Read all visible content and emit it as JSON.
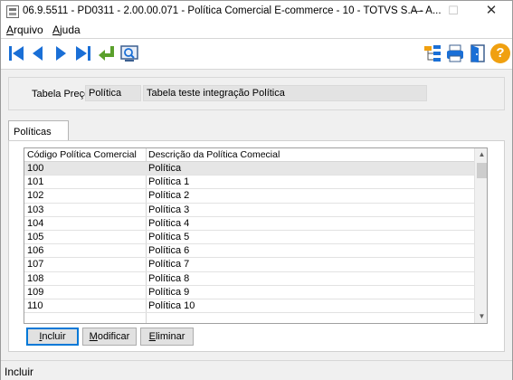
{
  "window": {
    "title": "06.9.5511 - PD0311 - 2.00.00.071 - Política Comercial E-commerce - 10 - TOTVS S.A - A...",
    "minimize_glyph": "—",
    "maximize_glyph": "☐",
    "close_glyph": "✕"
  },
  "menu": {
    "arquivo_prefix": "A",
    "arquivo_rest": "rquivo",
    "ajuda_prefix": "A",
    "ajuda_rest": "juda"
  },
  "toolbar": {
    "icons": [
      "first-record-icon",
      "previous-record-icon",
      "next-record-icon",
      "last-record-icon",
      "return-icon",
      "zoom-search-icon",
      "tree-icon",
      "print-icon",
      "exit-door-icon",
      "help-icon"
    ],
    "help_glyph": "?",
    "colors": {
      "nav_blue": "#1a6fd6",
      "return_green": "#5aa02c",
      "help_orange": "#f0a010"
    }
  },
  "header": {
    "label": "Tabela Preço:",
    "code_value": "Política",
    "description_value": "Tabela teste integração Política"
  },
  "tabs": [
    {
      "label": "Políticas"
    }
  ],
  "grid": {
    "columns": [
      "Código Política Comercial",
      "Descrição da Política Comecial"
    ],
    "rows": [
      {
        "code": "100",
        "desc": "Política"
      },
      {
        "code": "101",
        "desc": "Política 1"
      },
      {
        "code": "102",
        "desc": "Política 2"
      },
      {
        "code": "103",
        "desc": "Política 3"
      },
      {
        "code": "104",
        "desc": "Política 4"
      },
      {
        "code": "105",
        "desc": "Política 5"
      },
      {
        "code": "106",
        "desc": "Política 6"
      },
      {
        "code": "107",
        "desc": "Política 7"
      },
      {
        "code": "108",
        "desc": "Política 8"
      },
      {
        "code": "109",
        "desc": "Política 9"
      },
      {
        "code": "110",
        "desc": "Política 10"
      },
      {
        "code": "",
        "desc": ""
      }
    ],
    "selected_row": 0,
    "scroll_up_glyph": "▲",
    "scroll_down_glyph": "▼"
  },
  "buttons": {
    "incluir_prefix": "I",
    "incluir_rest": "ncluir",
    "modificar_prefix": "M",
    "modificar_rest": "odificar",
    "eliminar_prefix": "E",
    "eliminar_rest": "liminar"
  },
  "status": {
    "text": "Incluir"
  }
}
